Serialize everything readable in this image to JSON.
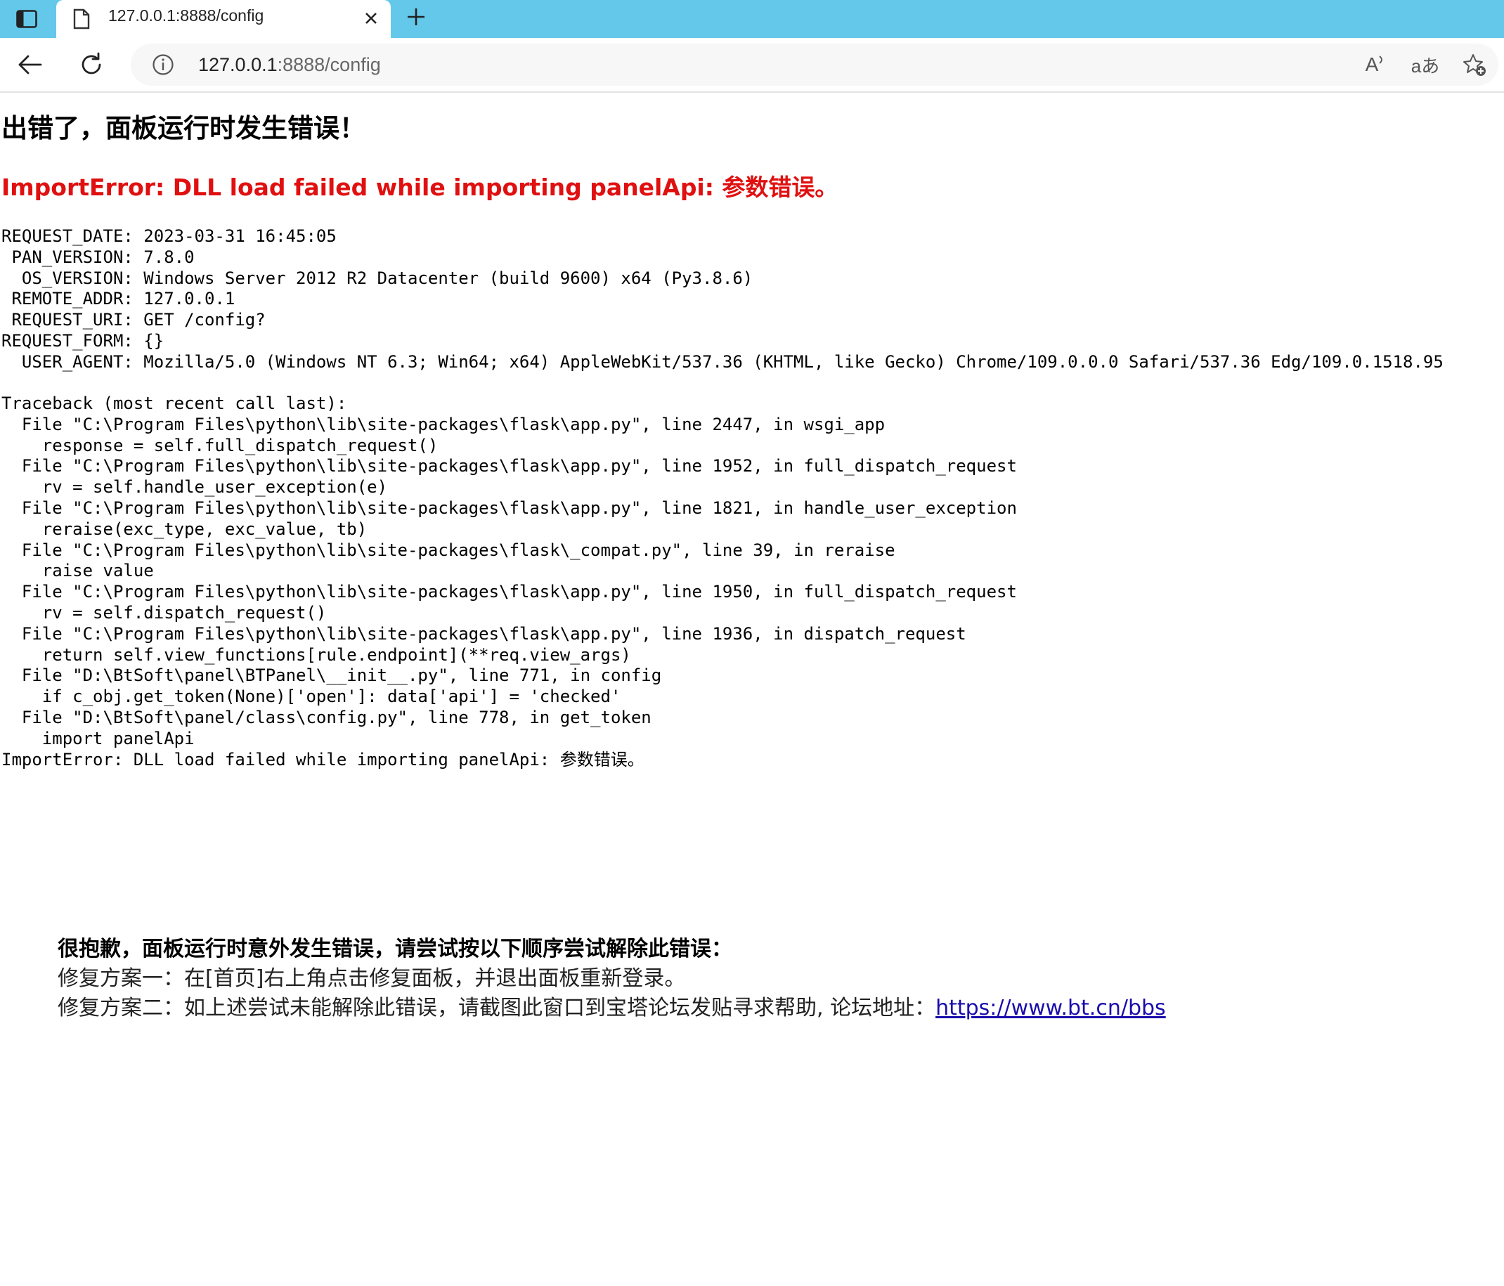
{
  "browser": {
    "tab": {
      "title": "127.0.0.1:8888/config"
    },
    "address": {
      "host": "127.0.0.1",
      "rest": ":8888/config"
    },
    "toolbar_icons": [
      "sidebar-icon",
      "document-icon",
      "close-icon",
      "plus-icon",
      "back-arrow-icon",
      "reload-icon",
      "info-icon",
      "read-aloud-icon",
      "translate-icon",
      "add-favorite-icon"
    ],
    "read_aloud_label": "A",
    "translate_label": "aあ",
    "colors": {
      "tab_strip": "#63c8ea",
      "error_red": "#e01010",
      "link": "#1a0dab"
    }
  },
  "page": {
    "title": "出错了，面板运行时发生错误！",
    "error_message": "ImportError: DLL load failed while importing panelApi: 参数错误。",
    "request_info": [
      "REQUEST_DATE: 2023-03-31 16:45:05",
      " PAN_VERSION: 7.8.0",
      "  OS_VERSION: Windows Server 2012 R2 Datacenter (build 9600) x64 (Py3.8.6)",
      " REMOTE_ADDR: 127.0.0.1",
      " REQUEST_URI: GET /config?",
      "REQUEST_FORM: {}",
      "  USER_AGENT: Mozilla/5.0 (Windows NT 6.3; Win64; x64) AppleWebKit/537.36 (KHTML, like Gecko) Chrome/109.0.0.0 Safari/537.36 Edg/109.0.1518.95"
    ],
    "traceback": [
      "Traceback (most recent call last):",
      "  File \"C:\\Program Files\\python\\lib\\site-packages\\flask\\app.py\", line 2447, in wsgi_app",
      "    response = self.full_dispatch_request()",
      "  File \"C:\\Program Files\\python\\lib\\site-packages\\flask\\app.py\", line 1952, in full_dispatch_request",
      "    rv = self.handle_user_exception(e)",
      "  File \"C:\\Program Files\\python\\lib\\site-packages\\flask\\app.py\", line 1821, in handle_user_exception",
      "    reraise(exc_type, exc_value, tb)",
      "  File \"C:\\Program Files\\python\\lib\\site-packages\\flask\\_compat.py\", line 39, in reraise",
      "    raise value",
      "  File \"C:\\Program Files\\python\\lib\\site-packages\\flask\\app.py\", line 1950, in full_dispatch_request",
      "    rv = self.dispatch_request()",
      "  File \"C:\\Program Files\\python\\lib\\site-packages\\flask\\app.py\", line 1936, in dispatch_request",
      "    return self.view_functions[rule.endpoint](**req.view_args)",
      "  File \"D:\\BtSoft\\panel\\BTPanel\\__init__.py\", line 771, in config",
      "    if c_obj.get_token(None)['open']: data['api'] = 'checked'",
      "  File \"D:\\BtSoft\\panel/class\\config.py\", line 778, in get_token",
      "    import panelApi",
      "ImportError: DLL load failed while importing panelApi: 参数错误。"
    ],
    "help": {
      "title": "很抱歉，面板运行时意外发生错误，请尝试按以下顺序尝试解除此错误：",
      "fix1": "修复方案一：在[首页]右上角点击修复面板，并退出面板重新登录。",
      "fix2_prefix": "修复方案二：如上述尝试未能解除此错误，请截图此窗口到宝塔论坛发贴寻求帮助, 论坛地址：",
      "link": "https://www.bt.cn/bbs"
    }
  }
}
